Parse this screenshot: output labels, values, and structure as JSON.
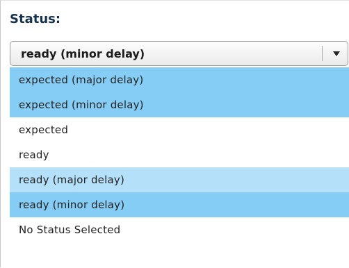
{
  "status_field": {
    "label": "Status:",
    "selected_value": "ready (minor delay)",
    "arrow_icon": "chevron-down-icon"
  },
  "dropdown": {
    "options": [
      {
        "label": "expected (major delay)",
        "state": "selected"
      },
      {
        "label": "expected (minor delay)",
        "state": "selected"
      },
      {
        "label": "expected",
        "state": "normal"
      },
      {
        "label": "ready",
        "state": "normal"
      },
      {
        "label": "ready (major delay)",
        "state": "hover"
      },
      {
        "label": "ready (minor delay)",
        "state": "selected"
      },
      {
        "label": "No Status Selected",
        "state": "normal"
      }
    ]
  },
  "colors": {
    "label_text": "#16324f",
    "selected_option_bg": "#86cdf5",
    "hover_option_bg": "#b5e0fa"
  }
}
